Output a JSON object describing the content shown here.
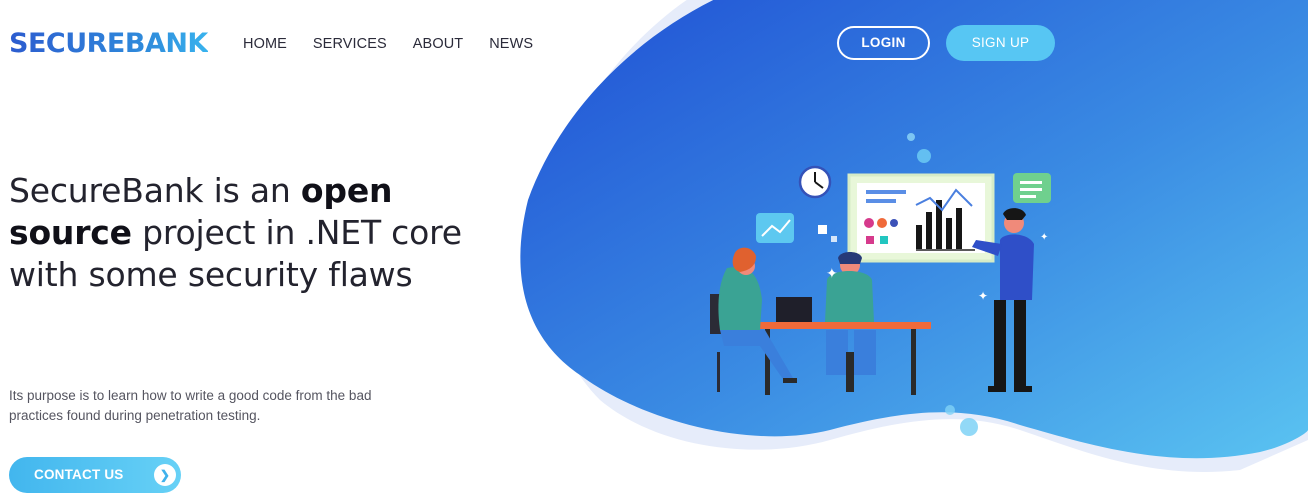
{
  "brand": {
    "logo": "SECUREBANK"
  },
  "nav": {
    "items": [
      {
        "label": "HOME"
      },
      {
        "label": "SERVICES"
      },
      {
        "label": "ABOUT"
      },
      {
        "label": "NEWS"
      }
    ]
  },
  "auth": {
    "login_label": "LOGIN",
    "signup_label": "SIGN UP"
  },
  "hero": {
    "title_pre": "SecureBank is an ",
    "title_bold1": "open",
    "title_space": " ",
    "title_bold2": "source",
    "title_post": " project in .NET core with some security flaws",
    "description": "Its purpose is to learn how to write a good code from the bad practices found during penetration testing.",
    "cta_label": "CONTACT US",
    "cta_icon": "chevron-right-icon"
  },
  "colors": {
    "brand_blue": "#2c5ccf",
    "blob_start": "#2255d6",
    "blob_end": "#59c2f0",
    "accent_light": "#57c6f3"
  }
}
